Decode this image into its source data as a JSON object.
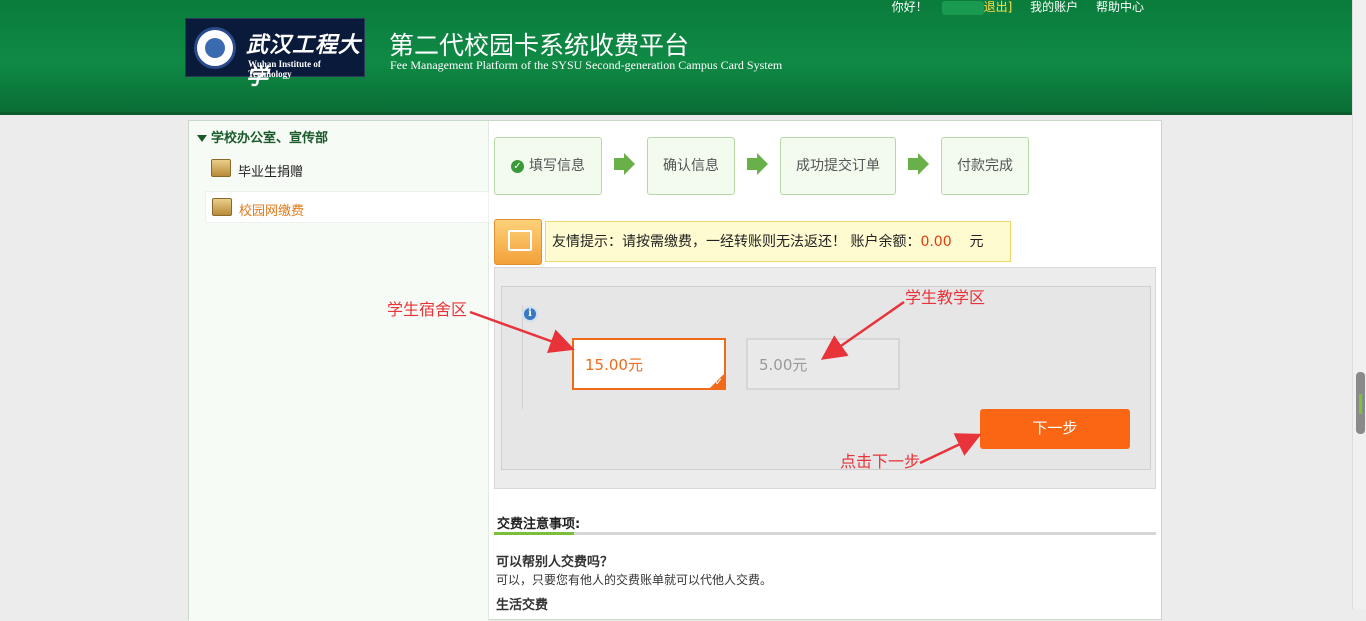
{
  "header": {
    "logo_cn": "武汉工程大学",
    "logo_en": "Wuhan Institute of Technology",
    "title": "第二代校园卡系统收费平台",
    "subtitle": "Fee Management Platform of the SYSU Second-generation Campus Card System",
    "greeting": "你好！",
    "logout": "退出]",
    "my_account": "我的账户",
    "help_center": "帮助中心"
  },
  "sidebar": {
    "section": "学校办公室、宣传部",
    "items": [
      {
        "label": "毕业生捐赠"
      },
      {
        "label": "校园网缴费"
      }
    ]
  },
  "steps": [
    {
      "label": "填写信息"
    },
    {
      "label": "确认信息"
    },
    {
      "label": "成功提交订单"
    },
    {
      "label": "付款完成"
    }
  ],
  "tip": {
    "text": "友情提示：请按需缴费，一经转账则无法返还！ 账户余额：",
    "balance": "0.00",
    "unit": "元"
  },
  "options": [
    {
      "label": "15.00元",
      "selected": true
    },
    {
      "label": "5.00元",
      "selected": false
    }
  ],
  "next_button": "下一步",
  "annotations": {
    "dorm": "学生宿舍区",
    "teaching": "学生教学区",
    "click_next": "点击下一步"
  },
  "notes": {
    "title": "交费注意事项:",
    "q1": "可以帮别人交费吗？",
    "a1": "可以，只要您有他人的交费账单就可以代他人交费。",
    "q2": "生活交费"
  },
  "colors": {
    "header_green": "#0f8a45",
    "accent_orange": "#fa6614",
    "annotation_red": "#e8333a"
  }
}
